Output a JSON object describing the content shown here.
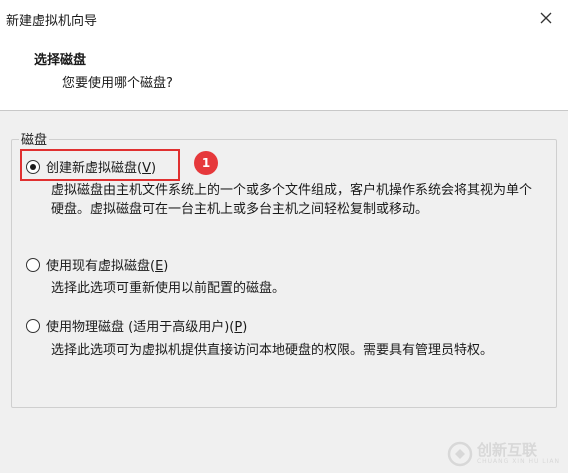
{
  "window": {
    "title": "新建虚拟机向导"
  },
  "header": {
    "title": "选择磁盘",
    "subtitle": "您要使用哪个磁盘?"
  },
  "group": {
    "label": "磁盘"
  },
  "options": [
    {
      "label": "创建新虚拟磁盘(",
      "mnemonic": "V",
      "label_end": ")",
      "checked": true,
      "description": "虚拟磁盘由主机文件系统上的一个或多个文件组成，客户机操作系统会将其视为单个硬盘。虚拟磁盘可在一台主机上或多台主机之间轻松复制或移动。"
    },
    {
      "label": "使用现有虚拟磁盘(",
      "mnemonic": "E",
      "label_end": ")",
      "checked": false,
      "description": "选择此选项可重新使用以前配置的磁盘。"
    },
    {
      "label": "使用物理磁盘 (适用于高级用户)(",
      "mnemonic": "P",
      "label_end": ")",
      "checked": false,
      "description": "选择此选项可为虚拟机提供直接访问本地硬盘的权限。需要具有管理员特权。"
    }
  ],
  "annotation": {
    "badge": "1",
    "color": "#e03030"
  },
  "watermark": {
    "text": "创新互联",
    "sub": "CHUANG XIN HU LIAN"
  }
}
